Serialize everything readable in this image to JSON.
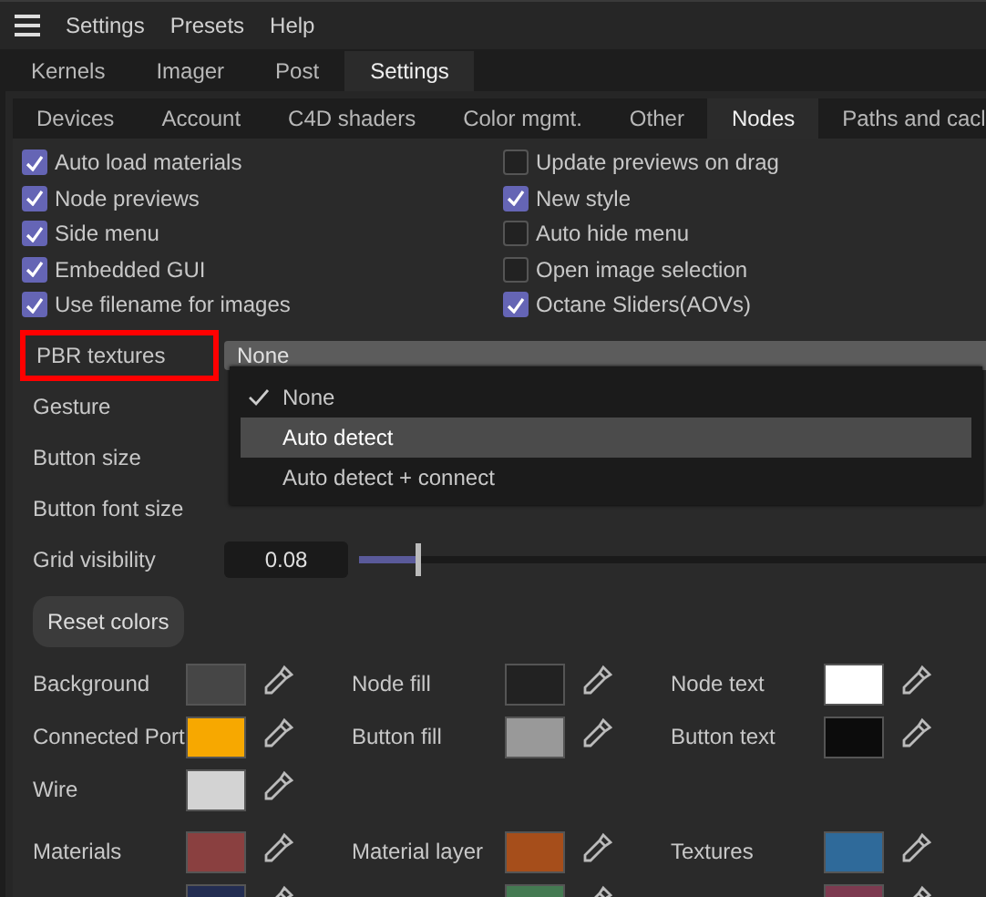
{
  "menu_bar": {
    "items": [
      "Settings",
      "Presets",
      "Help"
    ]
  },
  "tabs": [
    {
      "label": "Kernels",
      "selected": false
    },
    {
      "label": "Imager",
      "selected": false
    },
    {
      "label": "Post",
      "selected": false
    },
    {
      "label": "Settings",
      "selected": true
    }
  ],
  "sub_tabs": [
    {
      "label": "Devices",
      "selected": false
    },
    {
      "label": "Account",
      "selected": false
    },
    {
      "label": "C4D shaders",
      "selected": false
    },
    {
      "label": "Color mgmt.",
      "selected": false
    },
    {
      "label": "Other",
      "selected": false
    },
    {
      "label": "Nodes",
      "selected": true
    },
    {
      "label": "Paths and cacl",
      "selected": false
    }
  ],
  "checkboxes": [
    {
      "label": "Auto load materials",
      "checked": true
    },
    {
      "label": "Update previews on drag",
      "checked": false
    },
    {
      "label": "Node previews",
      "checked": true
    },
    {
      "label": "New style",
      "checked": true
    },
    {
      "label": "Side menu",
      "checked": true
    },
    {
      "label": "Auto hide menu",
      "checked": false
    },
    {
      "label": "Embedded GUI",
      "checked": true
    },
    {
      "label": "Open image selection",
      "checked": false
    },
    {
      "label": "Use filename for images",
      "checked": true
    },
    {
      "label": "Octane Sliders(AOVs)",
      "checked": true
    }
  ],
  "pbr_textures": {
    "label": "PBR textures",
    "highlighted": true,
    "value": "None",
    "options": [
      {
        "label": "None",
        "selected": true,
        "hovered": false
      },
      {
        "label": "Auto detect",
        "selected": false,
        "hovered": true
      },
      {
        "label": "Auto detect + connect",
        "selected": false,
        "hovered": false
      }
    ]
  },
  "settings_rows": [
    {
      "label": "Gesture"
    },
    {
      "label": "Button size"
    },
    {
      "label": "Button font size"
    }
  ],
  "grid_visibility": {
    "label": "Grid visibility",
    "value": "0.08",
    "level": 0.09
  },
  "reset_button": "Reset colors",
  "color_groups": [
    [
      [
        {
          "label": "Background",
          "color": "#464646"
        },
        {
          "label": "Node fill",
          "color": "#222222"
        },
        {
          "label": "Node text",
          "color": "#ffffff"
        }
      ],
      [
        {
          "label": "Connected Port",
          "color": "#f7a800"
        },
        {
          "label": "Button fill",
          "color": "#999999"
        },
        {
          "label": "Button text",
          "color": "#0c0c0c"
        }
      ],
      [
        {
          "label": "Wire",
          "color": "#d3d3d3"
        }
      ]
    ],
    [
      [
        {
          "label": "Materials",
          "color": "#8a4040"
        },
        {
          "label": "Material layer",
          "color": "#a64e1b"
        },
        {
          "label": "Textures",
          "color": "#2f6a9a"
        }
      ],
      [
        {
          "color": "#232d52"
        },
        {
          "color": "#447a52"
        },
        {
          "color": "#7d3a50"
        }
      ]
    ]
  ]
}
